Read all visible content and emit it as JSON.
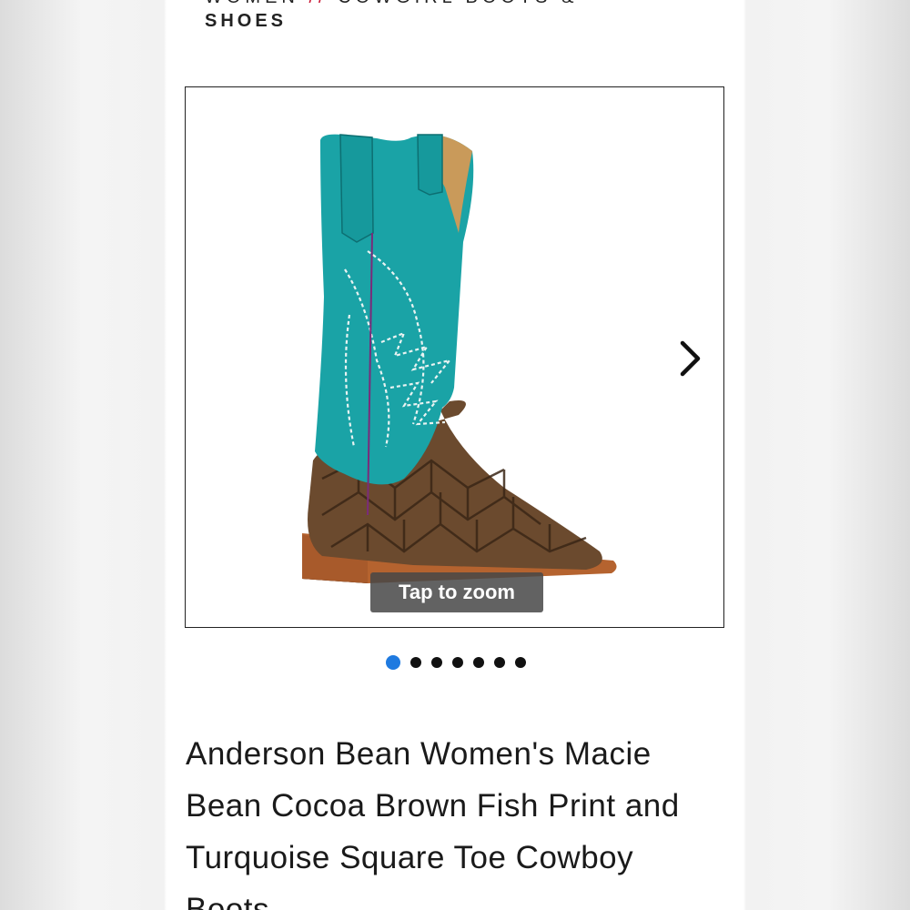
{
  "breadcrumb": {
    "top_left": "WOMEN",
    "separator": "//",
    "top_right": "COWGIRL BOOTS &",
    "bottom": "SHOES"
  },
  "gallery": {
    "zoom_hint": "Tap to zoom",
    "next_icon": "chevron-right-icon",
    "image_count": 7,
    "active_index": 0
  },
  "product": {
    "title": "Anderson Bean Women's Macie Bean Cocoa Brown Fish Print and Turquoise Square Toe Cowboy Boots"
  },
  "colors": {
    "accent": "#1f7ae0",
    "separator": "#c8102e",
    "boot_turquoise": "#1aa3a6",
    "boot_brown": "#6b4a2e"
  }
}
